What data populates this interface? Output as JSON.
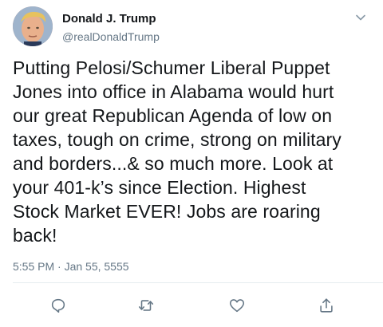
{
  "tweet": {
    "author_name": "Donald J. Trump",
    "author_handle": "@realDonaldTrump",
    "text": "Putting Pelosi/Schumer Liberal Puppet\nJones into office in Alabama would hurt\nour great Republican Agenda of low on\ntaxes, tough on crime, strong on military\nand borders...& so much more. Look at\nyour 401-k’s since Election. Highest\nStock Market EVER! Jobs are roaring\nback!",
    "timestamp": "5:55 PM · Jan 55, 5555"
  },
  "icons": {
    "menu": "chevron-down-icon",
    "reply": "reply-icon",
    "retweet": "retweet-icon",
    "like": "heart-icon",
    "share": "share-icon"
  },
  "colors": {
    "text": "#14171a",
    "secondary": "#657786",
    "divider": "#e6ecf0"
  }
}
